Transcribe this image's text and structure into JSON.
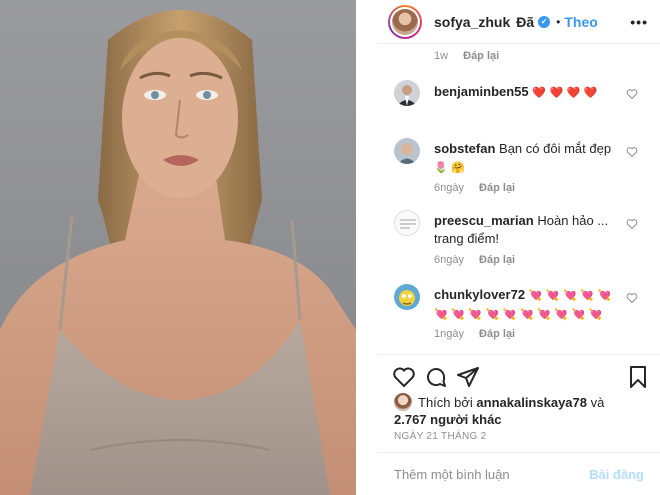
{
  "post": {
    "author": "sofya_zhuk",
    "author_suffix": "Đã",
    "separator": "•",
    "follow_label": "Theo",
    "more_label": "•••",
    "verified_mark": "✓"
  },
  "top_meta": {
    "time": "1w",
    "reply_label": "Đáp lại"
  },
  "comments": [
    {
      "username": "benjaminben55",
      "text": "❤️ ❤️ ❤️ ❤️",
      "time": "",
      "reply_label": ""
    },
    {
      "username": "sobstefan",
      "text": "Bạn có đôi mắt đẹp",
      "text_line2": "🌷 🤗",
      "time": "6ngày",
      "reply_label": "Đáp lại"
    },
    {
      "username": "preescu_marian",
      "text": "Hoàn hảo ...",
      "text_line2": "trang điểm!",
      "time": "6ngày",
      "reply_label": "Đáp lại"
    },
    {
      "username": "chunkylover72",
      "text": "💘 💘 💘 💘 💘",
      "text_line2": "💘 💘 💘 💘 💘 💘 💘 💘 💘 💘",
      "time": "1ngày",
      "reply_label": "Đáp lại"
    }
  ],
  "likes": {
    "prefix": "Thích bởi",
    "user": "annakalinskaya78",
    "and": "và",
    "others": "2.767 người khác"
  },
  "date_label": "NGÀY 21 THÁNG 2",
  "compose": {
    "placeholder": "Thêm một bình luận",
    "post_label": "Bài đăng"
  },
  "colors": {
    "accent": "#3897f0",
    "post_disabled": "#b2dffc",
    "muted": "#8e8e8e",
    "text": "#262626"
  },
  "icons": [
    "heart-icon",
    "comment-icon",
    "share-icon",
    "bookmark-icon",
    "more-icon",
    "verified-icon"
  ]
}
